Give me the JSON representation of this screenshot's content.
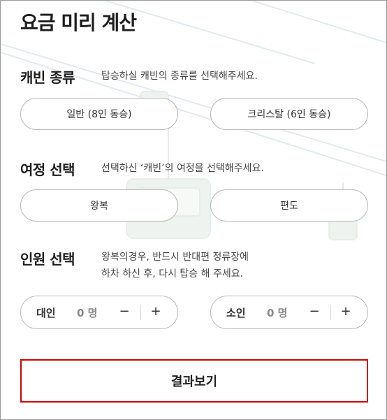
{
  "title": "요금 미리 계산",
  "cabin": {
    "heading": "캐빈 종류",
    "description": "탑승하실 캐빈의 종류를 선택해주세요.",
    "options": [
      "일반 (8인 동승)",
      "크리스탈 (6인 동승)"
    ]
  },
  "trip": {
    "heading": "여정 선택",
    "description": "선택하신 ‘캐빈’의 여정을 선택해주세요.",
    "options": [
      "왕복",
      "편도"
    ]
  },
  "people": {
    "heading": "인원 선택",
    "description_line1": "왕복의경우, 반드시 반대편 정류장에",
    "description_line2": "하차 하신 후, 다시 탑승 해 주세요.",
    "adult": {
      "label": "대인",
      "value": "0 명",
      "minus": "−",
      "plus": "+"
    },
    "child": {
      "label": "소인",
      "value": "0 명",
      "minus": "−",
      "plus": "+"
    }
  },
  "result_button": "결과보기",
  "colors": {
    "accent_border": "#d40000",
    "pill_border": "#b9b9b9",
    "count_value": "#8a8a8a"
  }
}
